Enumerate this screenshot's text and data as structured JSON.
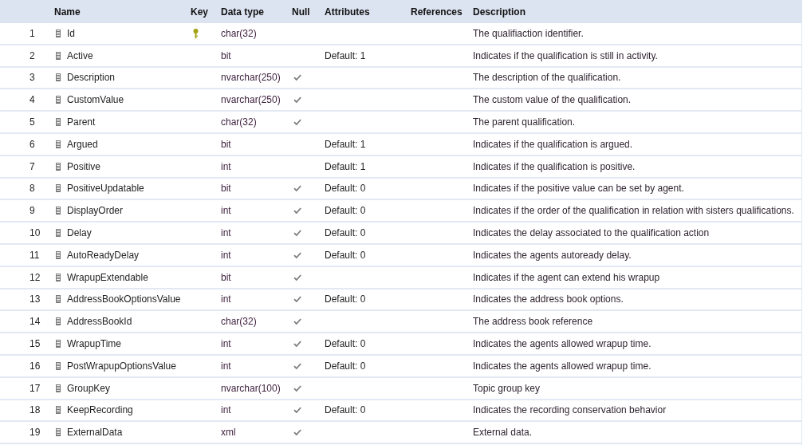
{
  "table": {
    "columns": [
      "Name",
      "Key",
      "Data type",
      "Null",
      "Attributes",
      "References",
      "Description"
    ],
    "rows": [
      {
        "number": "1",
        "name": "Id",
        "key": true,
        "data_type": "char(32)",
        "nullable": false,
        "description": "The qualifiaction identifier."
      },
      {
        "number": "2",
        "name": "Active",
        "key": false,
        "data_type": "bit",
        "nullable": false,
        "attributes": "Default: 1",
        "description": "Indicates if the qualification is still in activity."
      },
      {
        "number": "3",
        "name": "Description",
        "key": false,
        "data_type": "nvarchar(250)",
        "nullable": true,
        "description": "The description of the qualification."
      },
      {
        "number": "4",
        "name": "CustomValue",
        "key": false,
        "data_type": "nvarchar(250)",
        "nullable": true,
        "description": "The custom value of the qualification."
      },
      {
        "number": "5",
        "name": "Parent",
        "key": false,
        "data_type": "char(32)",
        "nullable": true,
        "description": "The parent qualification."
      },
      {
        "number": "6",
        "name": "Argued",
        "key": false,
        "data_type": "bit",
        "nullable": false,
        "attributes": "Default: 1",
        "description": "Indicates if the qualification is argued."
      },
      {
        "number": "7",
        "name": "Positive",
        "key": false,
        "data_type": "int",
        "nullable": false,
        "attributes": "Default: 1",
        "description": "Indicates if the qualification is positive."
      },
      {
        "number": "8",
        "name": "PositiveUpdatable",
        "key": false,
        "data_type": "bit",
        "nullable": true,
        "attributes": "Default: 0",
        "description": "Indicates if the positive value can be set by agent."
      },
      {
        "number": "9",
        "name": "DisplayOrder",
        "key": false,
        "data_type": "int",
        "nullable": true,
        "attributes": "Default: 0",
        "description": "Indicates if the order of the qualification in relation with sisters qualifications."
      },
      {
        "number": "10",
        "name": "Delay",
        "key": false,
        "data_type": "int",
        "nullable": true,
        "attributes": "Default: 0",
        "description": "Indicates the delay associated to the qualification action"
      },
      {
        "number": "11",
        "name": "AutoReadyDelay",
        "key": false,
        "data_type": "int",
        "nullable": true,
        "attributes": "Default: 0",
        "description": "Indicates the agents autoready delay."
      },
      {
        "number": "12",
        "name": "WrapupExtendable",
        "key": false,
        "data_type": "bit",
        "nullable": true,
        "description": "Indicates if the agent can extend his wrapup"
      },
      {
        "number": "13",
        "name": "AddressBookOptionsValue",
        "key": false,
        "data_type": "int",
        "nullable": true,
        "attributes": "Default: 0",
        "description": "Indicates the address book options."
      },
      {
        "number": "14",
        "name": "AddressBookId",
        "key": false,
        "data_type": "char(32)",
        "nullable": true,
        "description": "The address book reference"
      },
      {
        "number": "15",
        "name": "WrapupTime",
        "key": false,
        "data_type": "int",
        "nullable": true,
        "attributes": "Default: 0",
        "description": "Indicates the agents allowed wrapup time."
      },
      {
        "number": "16",
        "name": "PostWrapupOptionsValue",
        "key": false,
        "data_type": "int",
        "nullable": true,
        "attributes": "Default: 0",
        "description": "Indicates the agents allowed wrapup time."
      },
      {
        "number": "17",
        "name": "GroupKey",
        "key": false,
        "data_type": "nvarchar(100)",
        "nullable": true,
        "description": "Topic group key"
      },
      {
        "number": "18",
        "name": "KeepRecording",
        "key": false,
        "data_type": "int",
        "nullable": true,
        "attributes": "Default: 0",
        "description": "Indicates the recording conservation behavior"
      },
      {
        "number": "19",
        "name": "ExternalData",
        "key": false,
        "data_type": "xml",
        "nullable": true,
        "description": "External data."
      }
    ]
  }
}
